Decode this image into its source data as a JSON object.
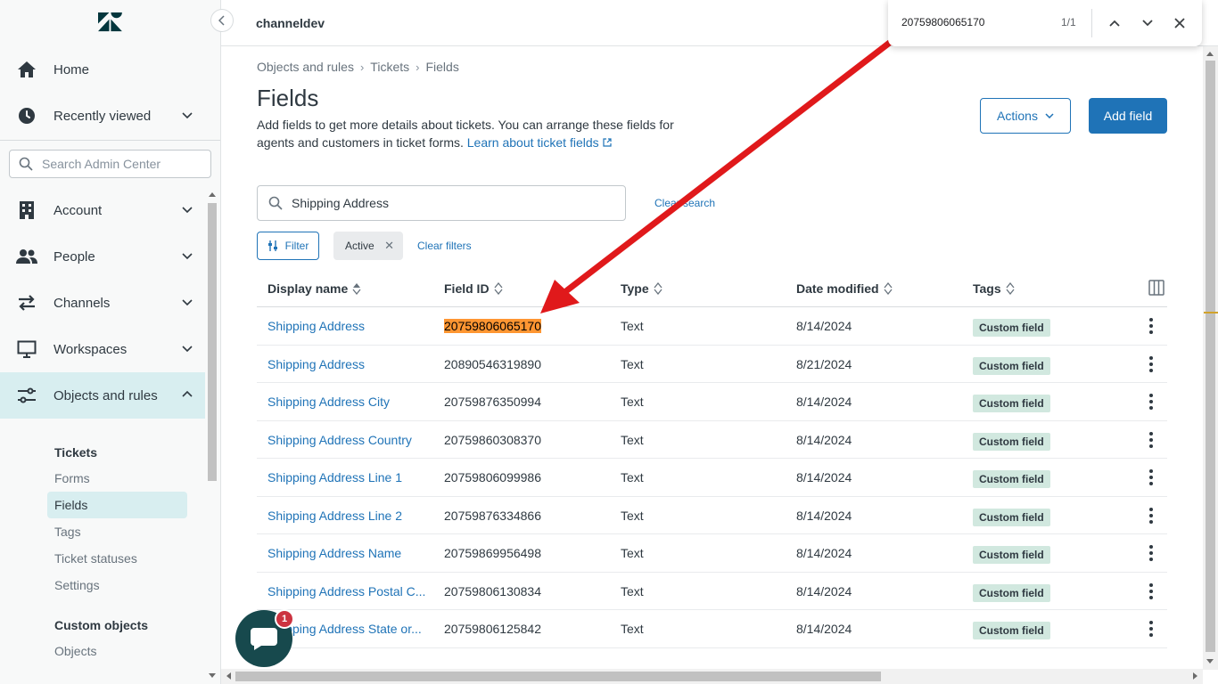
{
  "sidebar": {
    "nav": [
      {
        "label": "Home",
        "icon": "home-icon"
      },
      {
        "label": "Recently viewed",
        "icon": "clock-icon"
      },
      {
        "label": "Account",
        "icon": "building-icon"
      },
      {
        "label": "People",
        "icon": "people-icon"
      },
      {
        "label": "Channels",
        "icon": "arrows-icon"
      },
      {
        "label": "Workspaces",
        "icon": "monitor-icon"
      },
      {
        "label": "Objects and rules",
        "icon": "objects-icon"
      }
    ],
    "search_placeholder": "Search Admin Center",
    "tickets_heading": "Tickets",
    "tickets_items": [
      "Forms",
      "Fields",
      "Tags",
      "Ticket statuses",
      "Settings"
    ],
    "custom_objects_heading": "Custom objects",
    "custom_objects_items": [
      "Objects"
    ]
  },
  "header": {
    "brand": "channeldev"
  },
  "findbar": {
    "query": "20759806065170",
    "count": "1/1"
  },
  "breadcrumb": [
    "Objects and rules",
    "Tickets",
    "Fields"
  ],
  "page": {
    "title": "Fields",
    "description": "Add fields to get more details about tickets. You can arrange these fields for agents and customers in ticket forms.",
    "learn_link": "Learn about ticket fields",
    "actions_label": "Actions",
    "add_label": "Add field"
  },
  "table_search": {
    "value": "Shipping Address",
    "clear_label": "Clear search"
  },
  "filters": {
    "filter_label": "Filter",
    "chip_label": "Active",
    "clear_label": "Clear filters"
  },
  "table": {
    "columns": [
      "Display name",
      "Field ID",
      "Type",
      "Date modified",
      "Tags"
    ],
    "rows": [
      {
        "name": "Shipping Address",
        "id": "20759806065170",
        "type": "Text",
        "date": "8/14/2024",
        "tag": "Custom field"
      },
      {
        "name": "Shipping Address",
        "id": "20890546319890",
        "type": "Text",
        "date": "8/21/2024",
        "tag": "Custom field"
      },
      {
        "name": "Shipping Address City",
        "id": "20759876350994",
        "type": "Text",
        "date": "8/14/2024",
        "tag": "Custom field"
      },
      {
        "name": "Shipping Address Country",
        "id": "20759860308370",
        "type": "Text",
        "date": "8/14/2024",
        "tag": "Custom field"
      },
      {
        "name": "Shipping Address Line 1",
        "id": "20759806099986",
        "type": "Text",
        "date": "8/14/2024",
        "tag": "Custom field"
      },
      {
        "name": "Shipping Address Line 2",
        "id": "20759876334866",
        "type": "Text",
        "date": "8/14/2024",
        "tag": "Custom field"
      },
      {
        "name": "Shipping Address Name",
        "id": "20759869956498",
        "type": "Text",
        "date": "8/14/2024",
        "tag": "Custom field"
      },
      {
        "name": "Shipping Address Postal C...",
        "id": "20759806130834",
        "type": "Text",
        "date": "8/14/2024",
        "tag": "Custom field"
      },
      {
        "name": "Shipping Address State or...",
        "id": "20759806125842",
        "type": "Text",
        "date": "8/14/2024",
        "tag": "Custom field"
      }
    ]
  },
  "chat": {
    "badge": "1"
  },
  "colors": {
    "accent": "#1f73b7",
    "highlight": "#ff9632",
    "tag_bg": "#d1e8df",
    "active_nav": "#d8eef0",
    "arrow": "#e0191b"
  }
}
